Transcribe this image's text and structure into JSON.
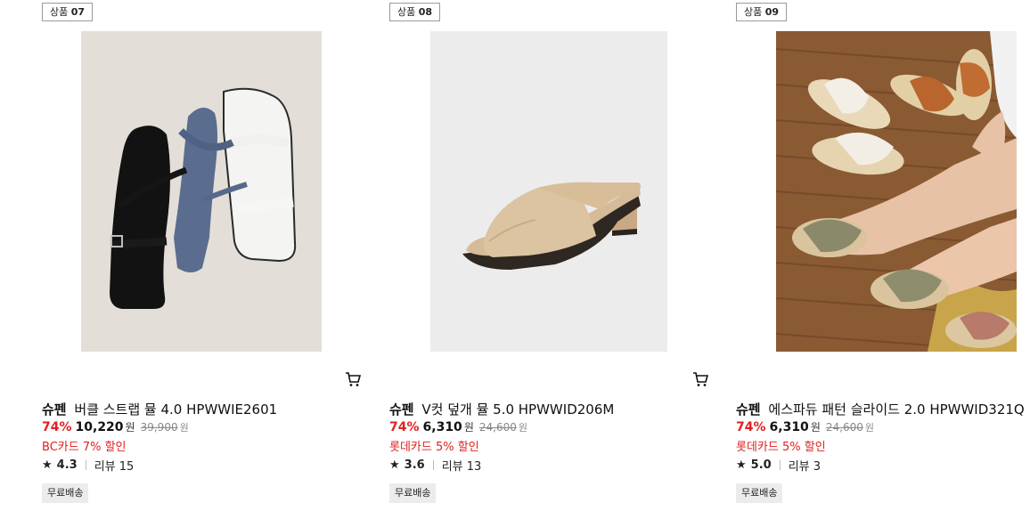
{
  "products": [
    {
      "tag_prefix": "상품",
      "tag_no": "07",
      "brand": "슈펜",
      "name": "버클 스트랩 뮬 4.0 HPWWIE2601",
      "discount_rate": "74%",
      "price": "10,220",
      "currency": "원",
      "original_price": "39,900",
      "promo": "BC카드 7% 할인",
      "rating": "4.3",
      "review_label": "리뷰 15",
      "shipping": "무료배송",
      "image": "black-white-strap-sandals-photo"
    },
    {
      "tag_prefix": "상품",
      "tag_no": "08",
      "brand": "슈펜",
      "name": "V컷 덮개 뮬 5.0 HPWWID206M",
      "discount_rate": "74%",
      "price": "6,310",
      "currency": "원",
      "original_price": "24,600",
      "promo": "롯데카드 5% 할인",
      "rating": "3.6",
      "review_label": "리뷰 13",
      "shipping": "무료배송",
      "image": "beige-mule-photo"
    },
    {
      "tag_prefix": "상품",
      "tag_no": "09",
      "brand": "슈펜",
      "name": "에스파듀 패턴 슬라이드 2.0 HPWWID321Q",
      "discount_rate": "74%",
      "price": "6,310",
      "currency": "원",
      "original_price": "24,600",
      "promo": "롯데카드 5% 할인",
      "rating": "5.0",
      "review_label": "리뷰 3",
      "shipping": "무료배송",
      "image": "espadrille-slides-photo"
    }
  ],
  "icons": {
    "cart": "cart-icon",
    "star": "star-icon"
  },
  "colors": {
    "discount": "#e02020",
    "text": "#111111",
    "muted": "#888888",
    "badge_bg": "#ececec"
  }
}
